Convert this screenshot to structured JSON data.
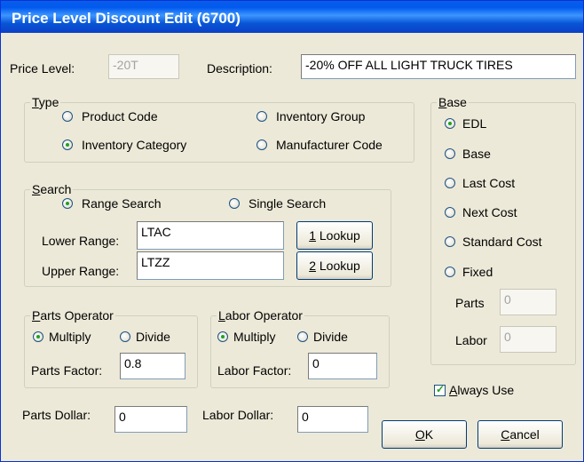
{
  "window": {
    "title": "Price Level Discount Edit (6700)"
  },
  "header": {
    "price_level_label": "Price Level:",
    "price_level_value": "-20T",
    "description_label": "Description:",
    "description_value": "-20% OFF ALL LIGHT TRUCK TIRES"
  },
  "type": {
    "legend_key": "T",
    "legend_rest": "ype",
    "options": [
      {
        "label": "Product Code",
        "selected": false
      },
      {
        "label": "Inventory Group",
        "selected": false
      },
      {
        "label": "Inventory Category",
        "selected": true
      },
      {
        "label": "Manufacturer Code",
        "selected": false
      }
    ]
  },
  "search": {
    "legend_key": "S",
    "legend_rest": "earch",
    "range_label": "Range Search",
    "single_label": "Single Search",
    "lower_label": "Lower Range:",
    "lower_value": "LTAC",
    "upper_label": "Upper Range:",
    "upper_value": "LTZZ",
    "lookup1_key": "1",
    "lookup1_rest": " Lookup",
    "lookup2_key": "2",
    "lookup2_rest": " Lookup"
  },
  "parts_operator": {
    "legend_key": "P",
    "legend_rest": "arts Operator",
    "multiply_label": "Multiply",
    "divide_label": "Divide",
    "factor_label": "Parts Factor:",
    "factor_value": "0.8"
  },
  "labor_operator": {
    "legend_key": "L",
    "legend_rest": "abor Operator",
    "multiply_label": "Multiply",
    "divide_label": "Divide",
    "factor_label": "Labor Factor:",
    "factor_value": "0"
  },
  "dollars": {
    "parts_label": "Parts Dollar:",
    "parts_value": "0",
    "labor_label": "Labor Dollar:",
    "labor_value": "0"
  },
  "base": {
    "legend_key": "B",
    "legend_rest": "ase",
    "options": [
      {
        "label": "EDL",
        "selected": true
      },
      {
        "label": "Base",
        "selected": false
      },
      {
        "label": "Last Cost",
        "selected": false
      },
      {
        "label": "Next Cost",
        "selected": false
      },
      {
        "label": "Standard Cost",
        "selected": false
      },
      {
        "label": "Fixed",
        "selected": false
      }
    ],
    "parts_label": "Parts",
    "parts_value": "0",
    "labor_label": "Labor",
    "labor_value": "0"
  },
  "always_use": {
    "key": "A",
    "rest": "lways Use",
    "checked": true
  },
  "buttons": {
    "ok_key": "O",
    "ok_rest": "K",
    "cancel_key": "C",
    "cancel_rest": "ancel"
  }
}
